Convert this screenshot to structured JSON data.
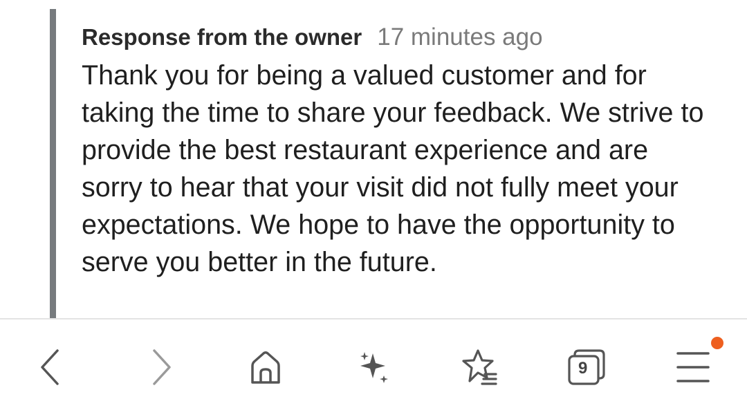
{
  "review_response": {
    "author": "Response from the owner",
    "time": "17 minutes ago",
    "text": "Thank you for being a valued customer and for taking the time to share your feedback. We strive to provide the best restaurant experience and are sorry to hear that your visit did not fully meet your expectations. We hope to have the opportunity to serve you better in the future."
  },
  "bottom_nav": {
    "items": [
      {
        "icon": "chevron-left-icon"
      },
      {
        "icon": "chevron-right-icon"
      },
      {
        "icon": "home-icon"
      },
      {
        "icon": "sparkles-icon"
      },
      {
        "icon": "star-list-icon"
      },
      {
        "icon": "tabs-icon",
        "count": "9"
      },
      {
        "icon": "menu-icon",
        "has_notification": true
      }
    ]
  },
  "colors": {
    "quote_bar": "#777b7e",
    "icon": "#555555",
    "notification": "#ee5f1f"
  }
}
